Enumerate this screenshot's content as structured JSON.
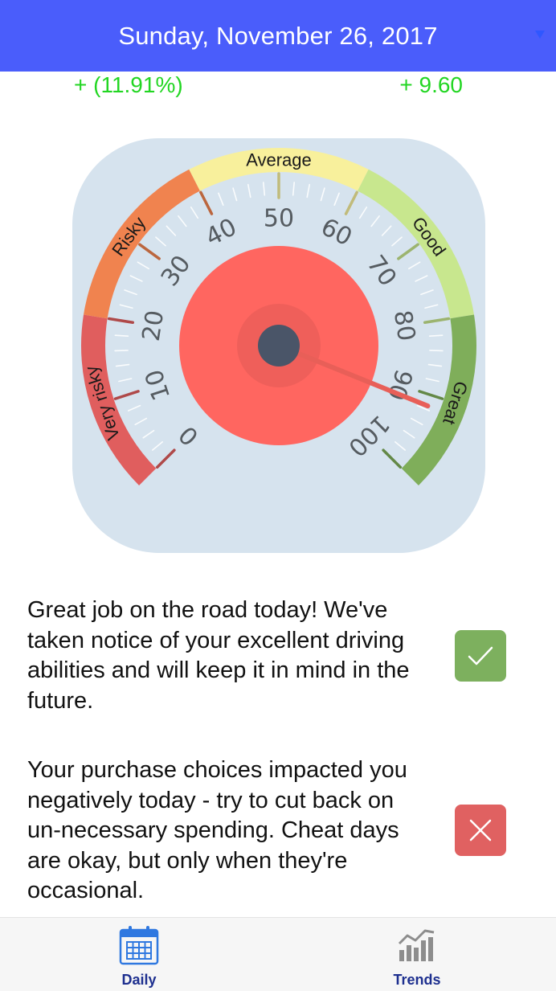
{
  "header": {
    "title": "Sunday, November 26, 2017",
    "caret_icon": "caret-down-icon"
  },
  "summary": {
    "percent_change": "+ (11.91%)",
    "score_change": "+ 9.60",
    "color": "#22d622"
  },
  "gauge": {
    "value": 91.5,
    "min": 0,
    "max": 100,
    "bands": [
      {
        "label": "Very risky",
        "from": 0,
        "to": 20,
        "color": "#e05e5e"
      },
      {
        "label": "Risky",
        "from": 20,
        "to": 40,
        "color": "#f0834f"
      },
      {
        "label": "Average",
        "from": 40,
        "to": 60,
        "color": "#f8f09c"
      },
      {
        "label": "Good",
        "from": 60,
        "to": 80,
        "color": "#c8e78e"
      },
      {
        "label": "Great",
        "from": 80,
        "to": 100,
        "color": "#7fae5a"
      }
    ],
    "tick_labels": [
      "0",
      "10",
      "20",
      "30",
      "40",
      "50",
      "60",
      "70",
      "80",
      "90",
      "100"
    ],
    "dial_color": "#ff6660",
    "hub_color": "#4a5568"
  },
  "messages": [
    {
      "text": "Great job on the road today! We've taken notice of your excellent driving abilities and will keep it in mind in the future.",
      "icon": "checkmark-icon",
      "color": "#7db05e"
    },
    {
      "text": "Your purchase choices impacted you negatively today - try to cut back on un-necessary spending. Cheat days are okay, but only when they're occasional.",
      "icon": "close-icon",
      "color": "#e06161"
    }
  ],
  "tabs": [
    {
      "label": "Daily",
      "icon": "calendar-icon",
      "active": true
    },
    {
      "label": "Trends",
      "icon": "bar-chart-icon",
      "active": false
    }
  ]
}
